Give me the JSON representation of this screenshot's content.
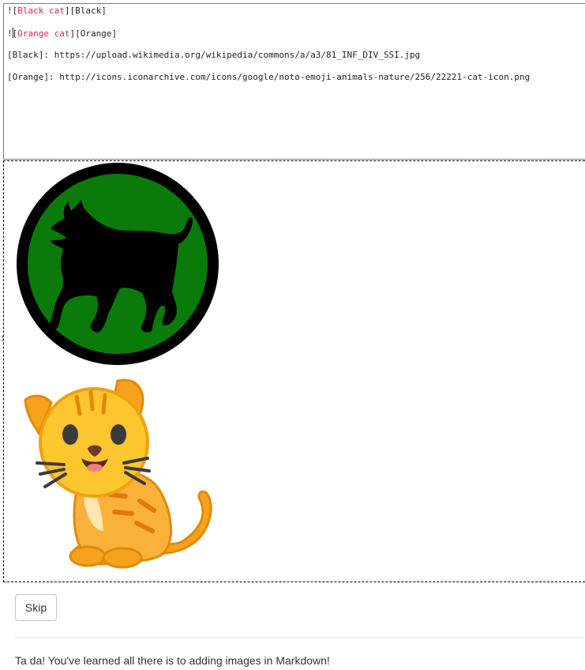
{
  "editor": {
    "line1": {
      "prefix": "![",
      "alt": "Black cat",
      "suffix": "][Black]"
    },
    "line2": {
      "prefix": "!",
      "open_bracket": "[",
      "alt": "Orange cat",
      "suffix": "][Orange]"
    },
    "line3": "[Black]: https://upload.wikimedia.org/wikipedia/commons/a/a3/81_INF_DIV_SSI.jpg",
    "line4": "[Orange]: http://icons.iconarchive.com/icons/google/noto-emoji-animals-nature/256/22221-cat-icon.png"
  },
  "preview": {
    "images": [
      {
        "alt": "Black cat",
        "icon": "black-cat-insignia"
      },
      {
        "alt": "Orange cat",
        "icon": "orange-cat-emoji"
      }
    ]
  },
  "skip_button": {
    "label": "Skip"
  },
  "footer": {
    "message": "Ta da! You've learned all there is to adding images in Markdown!"
  },
  "colors": {
    "alt_text": "#d12b4f",
    "insignia_green": "#0a7a0a",
    "cat_orange": "#f7a21c"
  }
}
